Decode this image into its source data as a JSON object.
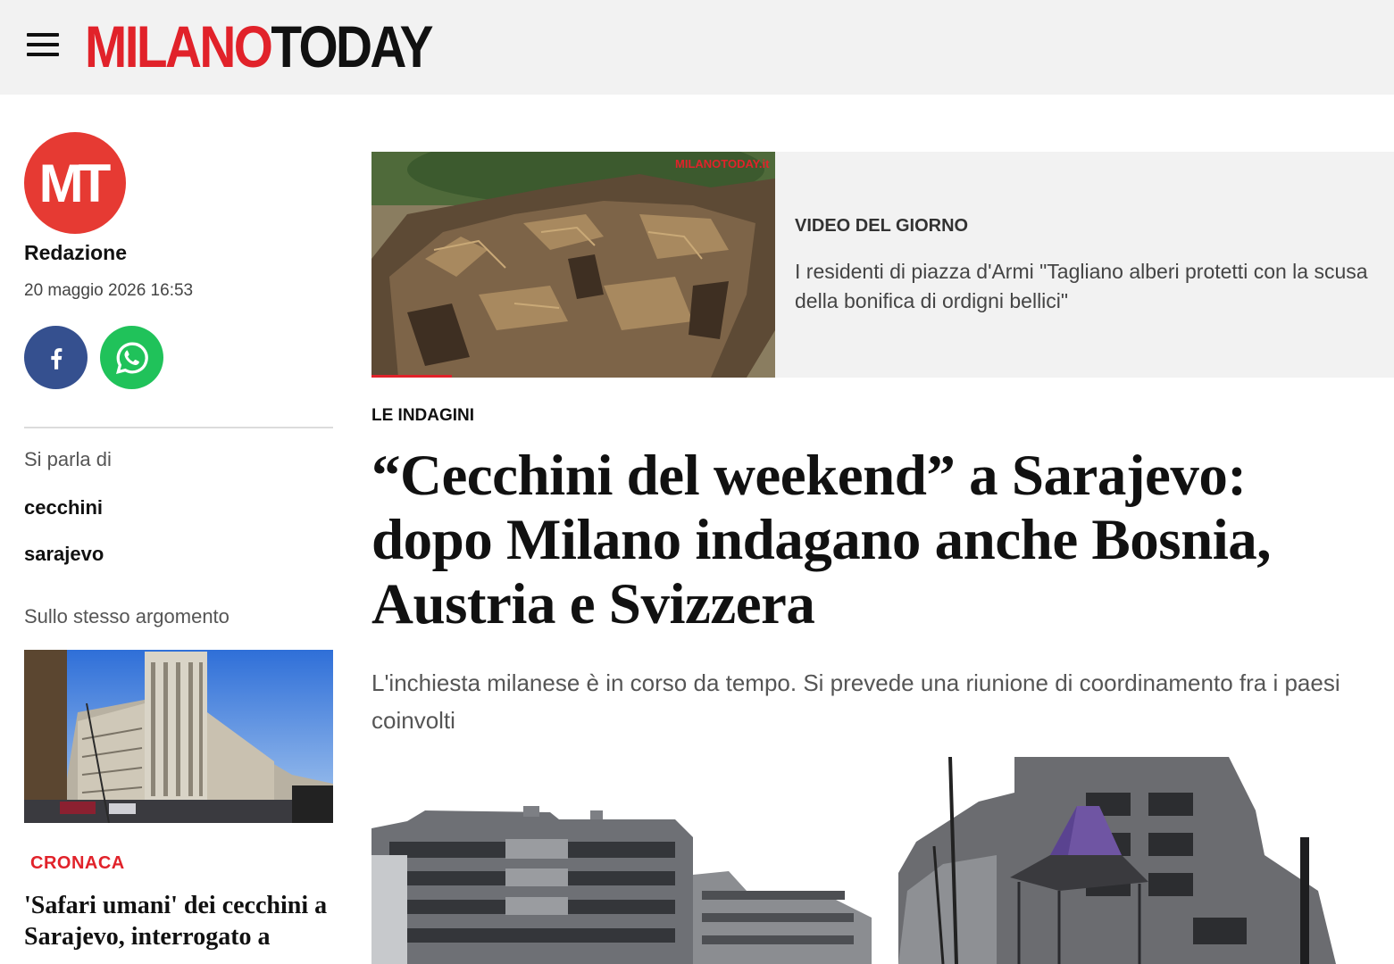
{
  "header": {
    "logo_red": "MILANO",
    "logo_black": "TODAY",
    "menu_icon": "hamburger-menu-icon"
  },
  "author": {
    "avatar_text": "MT",
    "name": "Redazione",
    "date": "20 maggio 2026 16:53"
  },
  "share": {
    "facebook_icon": "facebook-icon",
    "whatsapp_icon": "whatsapp-icon",
    "facebook_color": "#35508f",
    "whatsapp_color": "#20c25a"
  },
  "sidebar": {
    "topics_heading": "Si parla di",
    "tags": [
      "cecchini",
      "sarajevo"
    ],
    "related_heading": "Sullo stesso argomento",
    "related": {
      "category": "CRONACA",
      "title": "'Safari umani' dei cecchini a Sarajevo, interrogato a"
    }
  },
  "video": {
    "label": "VIDEO DEL GIORNO",
    "title": "I residenti di piazza d'Armi \"Tagliano alberi protetti con la scusa della bonifica di ordigni bellici\"",
    "watermark": "MILANOTODAY.it"
  },
  "article": {
    "kicker": "LE INDAGINI",
    "headline": "“Cecchini del weekend” a Sarajevo: dopo Milano indagano anche Bosnia, Austria e Svizzera",
    "subtitle": "L'inchiesta milanese è in corso da tempo. Si prevede una riunione di coordinamento fra i paesi coinvolti"
  },
  "colors": {
    "brand_red": "#e1222a",
    "header_bg": "#f2f2f2"
  }
}
